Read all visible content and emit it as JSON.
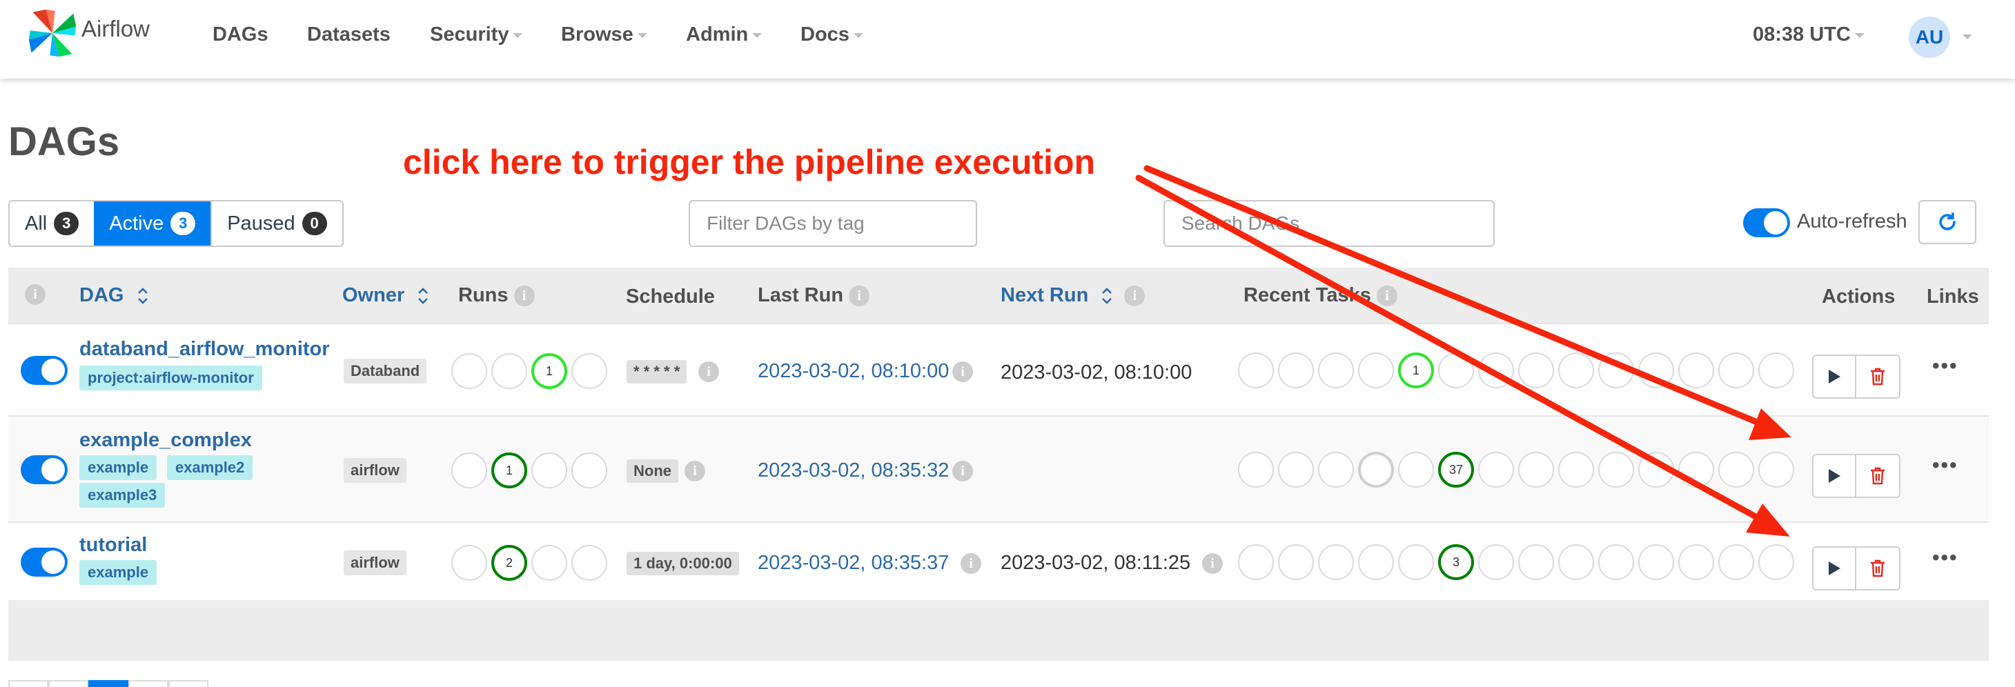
{
  "app": {
    "name": "Airflow",
    "time": "08:38 UTC",
    "user_initials": "AU"
  },
  "nav": [
    {
      "label": "DAGs",
      "dropdown": false
    },
    {
      "label": "Datasets",
      "dropdown": false
    },
    {
      "label": "Security",
      "dropdown": true
    },
    {
      "label": "Browse",
      "dropdown": true
    },
    {
      "label": "Admin",
      "dropdown": true
    },
    {
      "label": "Docs",
      "dropdown": true
    }
  ],
  "page": {
    "title": "DAGs",
    "annotation": "click here to trigger the pipeline execution",
    "annotation_color": "#f5260c"
  },
  "filters": {
    "all": {
      "label": "All",
      "count": "3"
    },
    "active": {
      "label": "Active",
      "count": "3"
    },
    "paused": {
      "label": "Paused",
      "count": "0"
    },
    "tag_placeholder": "Filter DAGs by tag",
    "search_placeholder": "Search DAGs",
    "autorefresh_label": "Auto-refresh",
    "autorefresh_on": true
  },
  "table": {
    "headers": {
      "dag": "DAG",
      "owner": "Owner",
      "runs": "Runs",
      "schedule": "Schedule",
      "last_run": "Last Run",
      "next_run": "Next Run",
      "recent_tasks": "Recent Tasks",
      "actions": "Actions",
      "links": "Links"
    },
    "rows": [
      {
        "name": "databand_airflow_monitor",
        "tags": [
          "project:airflow-monitor"
        ],
        "owner": "Databand",
        "runs": [
          "",
          "",
          "1",
          ""
        ],
        "schedule": "* * * * *",
        "last_run": "2023-03-02, 08:10:00",
        "next_run": "2023-03-02, 08:10:00",
        "recent_tasks": [
          "",
          "",
          "",
          "",
          "1",
          "",
          "",
          "",
          "",
          "",
          "",
          "",
          "",
          ""
        ]
      },
      {
        "name": "example_complex",
        "tags": [
          "example",
          "example2",
          "example3"
        ],
        "owner": "airflow",
        "runs": [
          "",
          "1",
          "",
          ""
        ],
        "schedule": "None",
        "last_run": "2023-03-02, 08:35:32",
        "next_run": "",
        "recent_tasks": [
          "",
          "",
          "",
          "",
          "",
          "37",
          "",
          "",
          "",
          "",
          "",
          "",
          "",
          ""
        ]
      },
      {
        "name": "tutorial",
        "tags": [
          "example"
        ],
        "owner": "airflow",
        "runs": [
          "",
          "2",
          "",
          ""
        ],
        "schedule": "1 day, 0:00:00",
        "last_run": "2023-03-02, 08:35:37",
        "next_run": "2023-03-02, 08:11:25",
        "recent_tasks": [
          "",
          "",
          "",
          "",
          "",
          "3",
          "",
          "",
          "",
          "",
          "",
          "",
          "",
          ""
        ]
      }
    ]
  },
  "colors": {
    "accent": "#017cee",
    "link": "#2c6aa5",
    "success": "#008000",
    "running": "#2ee52e",
    "delete": "#e5291c"
  },
  "icons": [
    "pinwheel-logo-icon",
    "caret-down-icon",
    "refresh-icon",
    "info-icon",
    "sort-icon",
    "play-icon",
    "trash-icon",
    "ellipsis-icon"
  ]
}
